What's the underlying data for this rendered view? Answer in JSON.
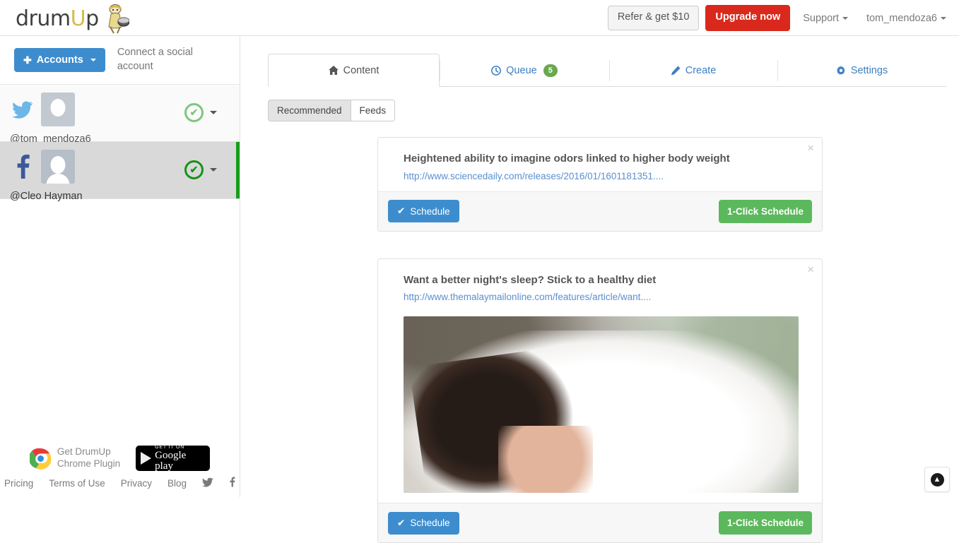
{
  "header": {
    "logo_text_1": "drum",
    "logo_text_u": "U",
    "logo_text_2": "p",
    "logo_alt": "drumUp",
    "refer_label": "Refer & get $10",
    "upgrade_label": "Upgrade now",
    "support_label": "Support",
    "user_label": "tom_mendoza6",
    "upgrade_color": "#d9291c",
    "link_color": "#7a7a7a"
  },
  "sidebar": {
    "accounts_button": "Accounts",
    "connect_text": "Connect a social account",
    "accounts": [
      {
        "network": "twitter",
        "handle": "@tom_mendoza6",
        "status": "connected",
        "active": false
      },
      {
        "network": "facebook",
        "handle": "@Cleo Hayman",
        "status": "connected",
        "active": true
      }
    ],
    "footer": {
      "chrome_plugin_line1": "Get DrumUp",
      "chrome_plugin_line2": "Chrome Plugin",
      "gplay_line1": "GET IT ON",
      "gplay_line2": "Google play",
      "links": [
        "Pricing",
        "Terms of Use",
        "Privacy",
        "Blog"
      ],
      "social": [
        "twitter-icon",
        "facebook-icon"
      ]
    }
  },
  "main": {
    "tabs": [
      {
        "label": "Content",
        "icon": "home-icon",
        "active": true,
        "badge": ""
      },
      {
        "label": "Queue",
        "icon": "clock-icon",
        "active": false,
        "badge": "5"
      },
      {
        "label": "Create",
        "icon": "pencil-icon",
        "active": false,
        "badge": ""
      },
      {
        "label": "Settings",
        "icon": "gear-icon",
        "active": false,
        "badge": ""
      }
    ],
    "badge_color": "#6aa84f",
    "filters": [
      {
        "label": "Recommended",
        "selected": true
      },
      {
        "label": "Feeds",
        "selected": false
      }
    ],
    "cards": [
      {
        "title": "Heightened ability to imagine odors linked to higher body weight",
        "url": "http://www.sciencedaily.com/releases/2016/01/1601181351....",
        "has_image": false,
        "schedule_label": "Schedule",
        "oneclick_label": "1-Click Schedule",
        "close_label": "×"
      },
      {
        "title": "Want a better night's sleep? Stick to a healthy diet",
        "url": "http://www.themalaymailonline.com/features/article/want....",
        "has_image": true,
        "image_alt": "Woman sleeping under a white duvet",
        "schedule_label": "Schedule",
        "oneclick_label": "1-Click Schedule",
        "close_label": "×"
      }
    ],
    "scroll_top_icon": "arrow-up-icon"
  }
}
